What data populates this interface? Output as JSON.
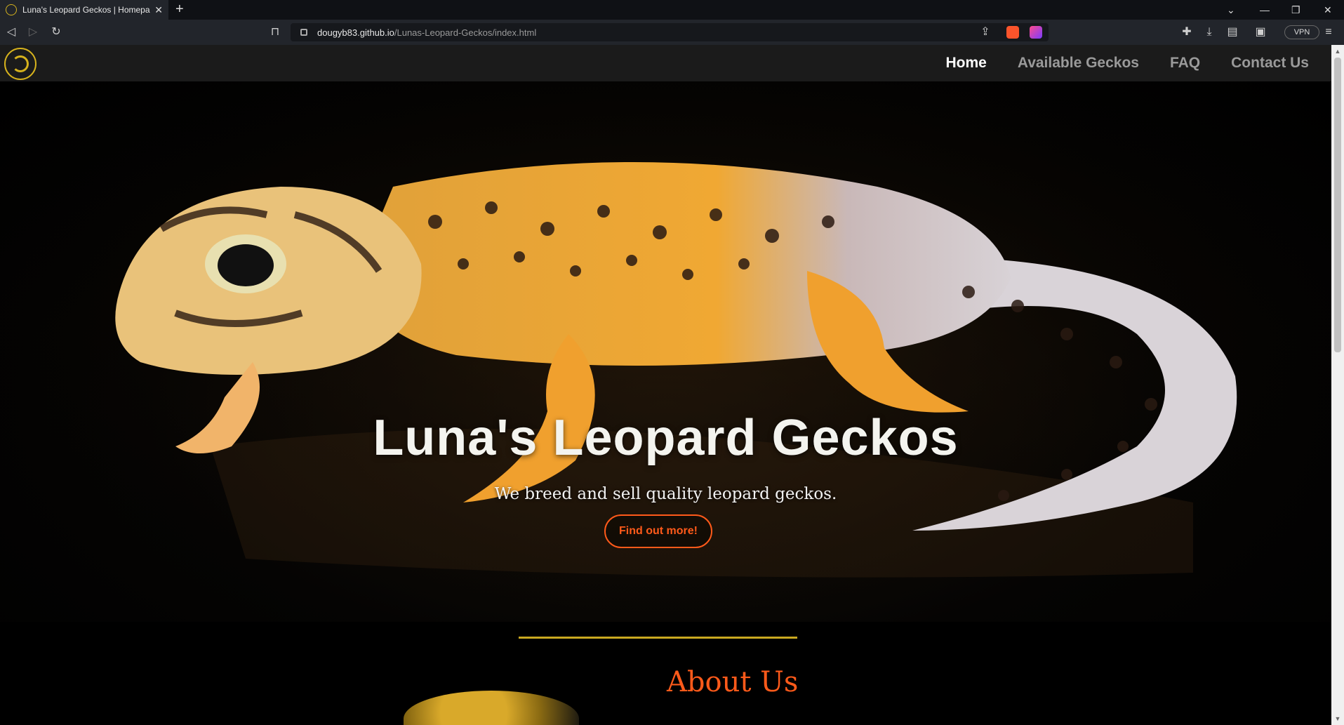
{
  "browser": {
    "tab_title": "Luna's Leopard Geckos | Homepa",
    "tab_close": "✕",
    "new_tab": "+",
    "url_host": "dougyb83.github.io",
    "url_path": "/Lunas-Leopard-Geckos/index.html",
    "vpn_label": "VPN",
    "icons": [
      "back-icon",
      "forward-icon",
      "reload-icon",
      "bookmark-icon",
      "share-icon",
      "brave-shield-icon",
      "rewards-icon",
      "extensions-icon",
      "download-icon",
      "sidebar-icon",
      "wallet-icon",
      "menu-icon"
    ]
  },
  "nav": {
    "items": [
      {
        "label": "Home",
        "active": true
      },
      {
        "label": "Available Geckos",
        "active": false
      },
      {
        "label": "FAQ",
        "active": false
      },
      {
        "label": "Contact Us",
        "active": false
      }
    ]
  },
  "hero": {
    "title": "Luna's Leopard Geckos",
    "subtitle": "We breed and sell quality leopard geckos.",
    "button_label": "Find out more!"
  },
  "about": {
    "title": "About Us"
  },
  "colors": {
    "accent": "#ff5a1a",
    "gold": "#d6b21d",
    "nav_bg": "#1b1b1b"
  }
}
